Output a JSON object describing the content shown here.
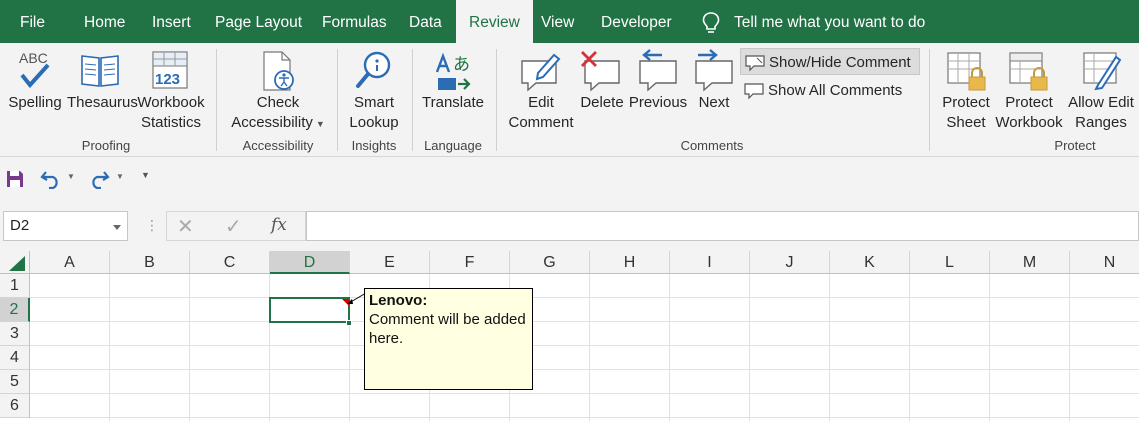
{
  "tabs": [
    {
      "label": "File",
      "name": "tab-file"
    },
    {
      "label": "Home",
      "name": "tab-home"
    },
    {
      "label": "Insert",
      "name": "tab-insert"
    },
    {
      "label": "Page Layout",
      "name": "tab-page-layout"
    },
    {
      "label": "Formulas",
      "name": "tab-formulas"
    },
    {
      "label": "Data",
      "name": "tab-data"
    },
    {
      "label": "Review",
      "name": "tab-review",
      "active": true
    },
    {
      "label": "View",
      "name": "tab-view"
    },
    {
      "label": "Developer",
      "name": "tab-developer"
    }
  ],
  "tell_me": "Tell me what you want to do",
  "ribbon": {
    "proofing": {
      "label": "Proofing",
      "spelling": "Spelling",
      "spelling_icon_text": "ABC",
      "thesaurus": "Thesaurus",
      "workbook_stats_l1": "Workbook",
      "workbook_stats_l2": "Statistics",
      "workbook_stats_icon_text": "123"
    },
    "accessibility": {
      "label": "Accessibility",
      "check_l1": "Check",
      "check_l2": "Accessibility"
    },
    "insights": {
      "label": "Insights",
      "smart_l1": "Smart",
      "smart_l2": "Lookup"
    },
    "language": {
      "label": "Language",
      "translate": "Translate",
      "translate_icon_text": "あ"
    },
    "comments": {
      "label": "Comments",
      "edit_l1": "Edit",
      "edit_l2": "Comment",
      "delete": "Delete",
      "previous": "Previous",
      "next": "Next",
      "show_hide": "Show/Hide Comment",
      "show_all": "Show All Comments"
    },
    "protect": {
      "label": "Protect",
      "sheet_l1": "Protect",
      "sheet_l2": "Sheet",
      "workbook_l1": "Protect",
      "workbook_l2": "Workbook",
      "ranges_l1": "Allow Edit",
      "ranges_l2": "Ranges"
    }
  },
  "formula_bar": {
    "name_box": "D2",
    "fx_label": "fx",
    "formula": ""
  },
  "grid": {
    "columns": [
      "A",
      "B",
      "C",
      "D",
      "E",
      "F",
      "G",
      "H",
      "I",
      "J",
      "K",
      "L",
      "M",
      "N"
    ],
    "rows": [
      "1",
      "2",
      "3",
      "4",
      "5",
      "6"
    ],
    "selected_column": "D",
    "selected_row": "2"
  },
  "comment": {
    "author": "Lenovo:",
    "text": "Comment will be added here."
  },
  "colors": {
    "accent": "#217346",
    "comment_bg": "#ffffe1",
    "delete_red": "#d13438",
    "icon_blue": "#2b6cb5"
  }
}
